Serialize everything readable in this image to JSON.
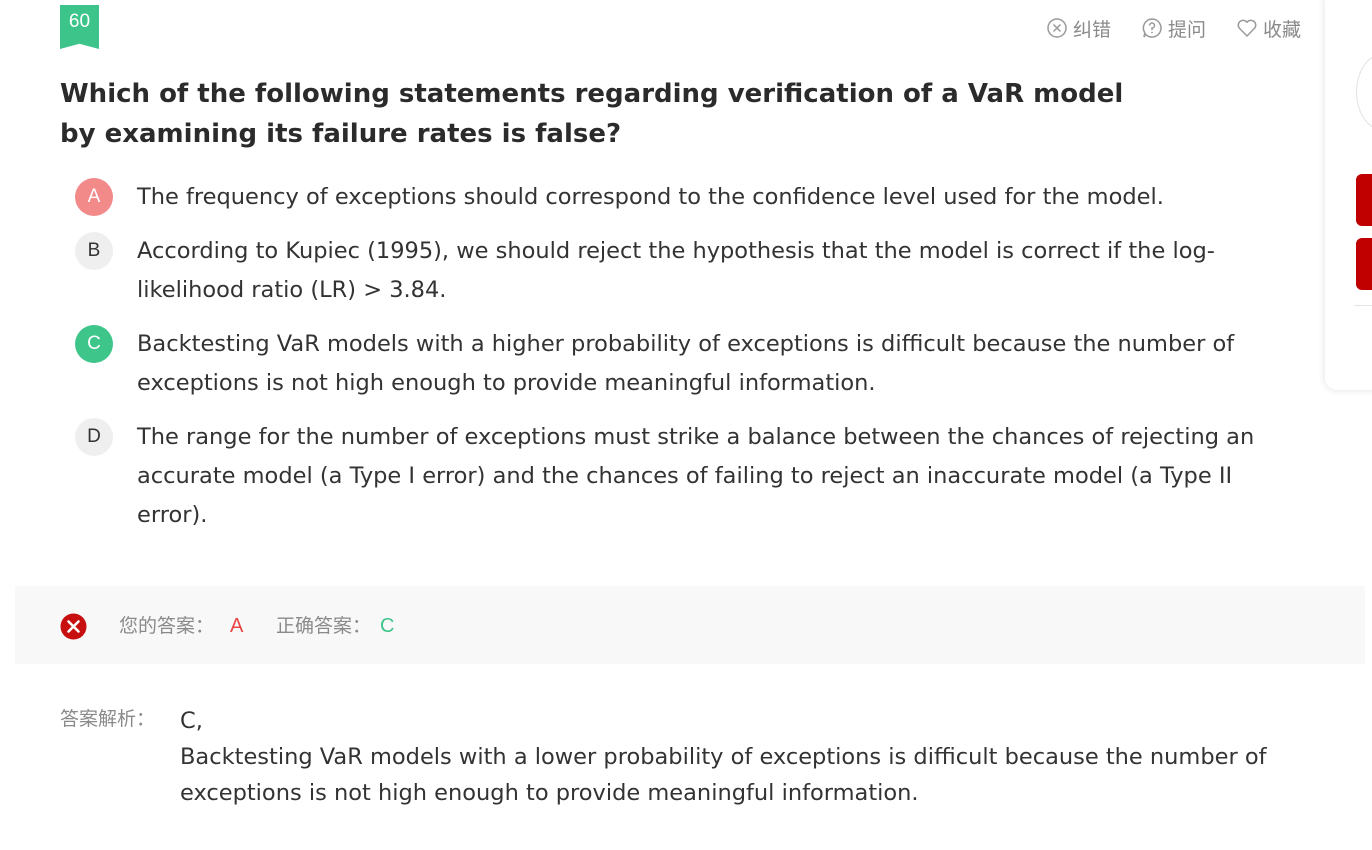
{
  "question": {
    "number": "60",
    "text": "Which of the following statements regarding verification of a VaR model by examining its failure rates is false?"
  },
  "actions": {
    "report_label": "纠错",
    "ask_label": "提问",
    "favorite_label": "收藏"
  },
  "options": [
    {
      "letter": "A",
      "text": "The frequency of exceptions should correspond to the confidence level used for the model.",
      "state": "wrong"
    },
    {
      "letter": "B",
      "text": "According to Kupiec (1995), we should reject the hypothesis that the model is correct if the log-likelihood ratio (LR) > 3.84.",
      "state": "neutral"
    },
    {
      "letter": "C",
      "text": "Backtesting VaR models with a higher probability of exceptions is difficult because the number of exceptions is not high enough to provide meaningful information.",
      "state": "correct"
    },
    {
      "letter": "D",
      "text": "The range for the number of exceptions must strike a balance between the chances of rejecting an accurate model (a Type I error) and the chances of failing to reject an inaccurate model (a Type II error).",
      "state": "neutral"
    }
  ],
  "result": {
    "your_answer_label": "您的答案：",
    "your_answer": "A",
    "correct_answer_label": "正确答案：",
    "correct_answer": "C"
  },
  "explanation": {
    "label": "答案解析：",
    "line1": "C,",
    "line2": "Backtesting VaR models with a lower probability of exceptions is difficult because the number of exceptions is not high enough to provide meaningful information."
  },
  "colors": {
    "accent_green": "#3cc48a",
    "wrong_red": "#e84545",
    "side_red": "#c00000"
  }
}
